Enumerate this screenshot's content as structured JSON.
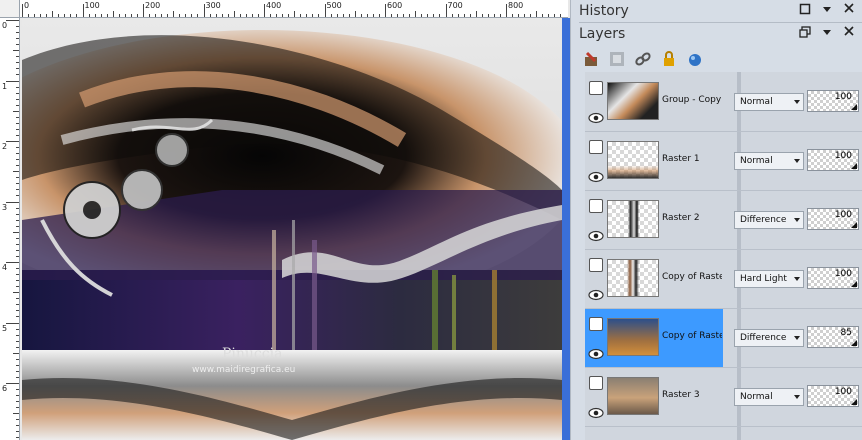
{
  "panels": {
    "history_title": "History",
    "layers_title": "Layers"
  },
  "rulers": {
    "top_labels": [
      "0",
      "100",
      "200",
      "300",
      "400",
      "500",
      "600",
      "700",
      "800"
    ],
    "left_labels": [
      "0",
      "1",
      "2",
      "3",
      "4",
      "5",
      "6"
    ]
  },
  "canvas_watermark": {
    "title": "Pinuccia",
    "url": "www.maidiregrafica.eu"
  },
  "layers": [
    {
      "name": "Group - Copy of",
      "blend": "Normal",
      "opacity": "100",
      "selected": false
    },
    {
      "name": "Raster 1",
      "blend": "Normal",
      "opacity": "100",
      "selected": false
    },
    {
      "name": "Raster 2",
      "blend": "Difference",
      "opacity": "100",
      "selected": false
    },
    {
      "name": "Copy of Raster",
      "blend": "Hard Light",
      "opacity": "100",
      "selected": false
    },
    {
      "name": "Copy of Raster",
      "blend": "Difference",
      "opacity": "85",
      "selected": true
    },
    {
      "name": "Raster 3",
      "blend": "Normal",
      "opacity": "100",
      "selected": false
    }
  ],
  "icons": {
    "history_header": [
      "restore-window-icon",
      "menu-arrow-icon",
      "close-icon"
    ],
    "layers_header": [
      "float-window-icon",
      "menu-arrow-icon",
      "close-icon"
    ],
    "toolbar": [
      "new-layer-icon",
      "properties-icon",
      "link-icon",
      "lock-icon",
      "mask-icon"
    ]
  },
  "colors": {
    "selection": "#3d9aff",
    "scrollbar": "#3a6fd8"
  }
}
